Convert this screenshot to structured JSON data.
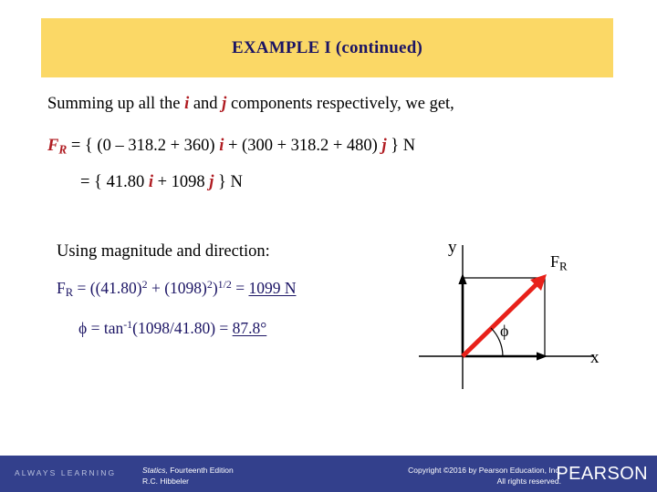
{
  "slide": {
    "title": "EXAMPLE I (continued)",
    "banner_color": "#fbd866",
    "title_color": "#1b1464"
  },
  "body": {
    "summing": {
      "part1": "Summing up all the ",
      "i": "i",
      "part2": " and ",
      "j": "j",
      "part3": " components respectively, we get,"
    },
    "equation_1": {
      "fr": "F",
      "fr_sub": "R",
      "open": " = { (0 ",
      "minus": "– ",
      "terms_i": "318.2 + 360) ",
      "i": "i",
      "plus": " + (300 + 318.2 + 480) ",
      "j": "j",
      "close": " } N"
    },
    "equation_2": {
      "lead": "= { 41.80 ",
      "i": "i",
      "mid": " + 1098 ",
      "j": "j",
      "close": " } N"
    },
    "using_heading": "Using magnitude and direction:",
    "magnitude": {
      "fr": "F",
      "fr_sub": "R",
      "expr": " = ((41.80)",
      "exp1": "2",
      "mid": " + (1098)",
      "exp2": "2",
      "close": ")",
      "half": "1/2",
      "equals": " = ",
      "result": "1099 N"
    },
    "angle": {
      "phi": "ϕ",
      "expr": " = tan",
      "exp": "-1",
      "args": "(1098/41.80) = ",
      "result": "87.8°"
    }
  },
  "diagram": {
    "axis_y_label": "y",
    "axis_x_label": "x",
    "resultant_label": "F",
    "resultant_sub": "R",
    "angle_label": "ϕ",
    "resultant_color": "#e8211a",
    "axis_color": "#000000"
  },
  "footer": {
    "always_learning": "ALWAYS LEARNING",
    "book_title": "Statics,",
    "book_edition": " Fourteenth Edition",
    "book_author": "R.C. Hibbeler",
    "copyright_line1": "Copyright ©2016 by Pearson Education, Inc.",
    "copyright_line2": "All rights reserved.",
    "brand": "PEARSON",
    "bar_color": "#33408c"
  }
}
